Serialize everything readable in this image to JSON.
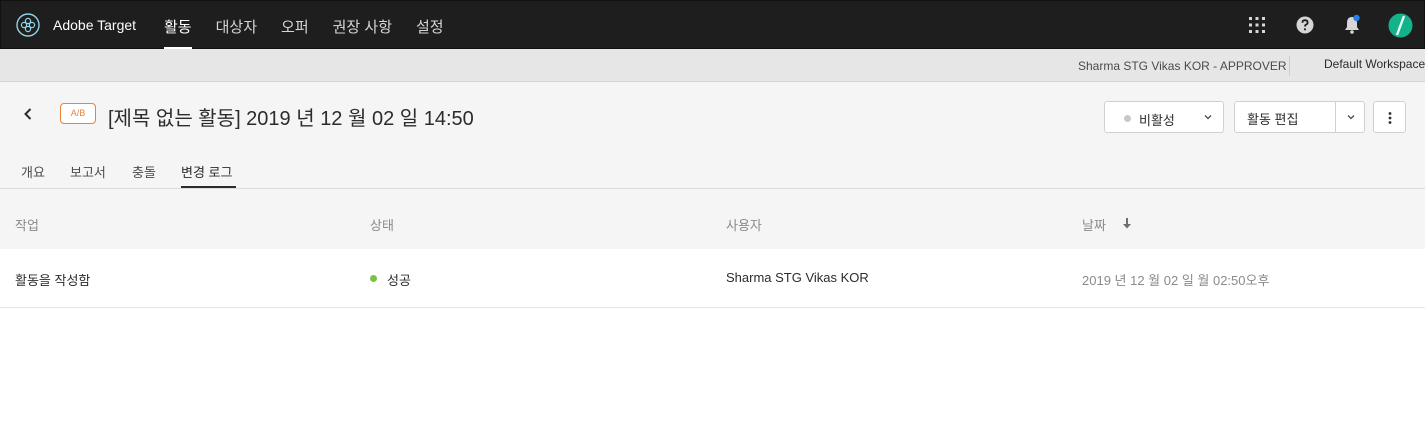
{
  "app": {
    "name": "Adobe Target",
    "nav": [
      "활동",
      "대상자",
      "오퍼",
      "권장 사항",
      "설정"
    ],
    "active_nav_index": 0
  },
  "workspace": {
    "user": "Sharma STG Vikas KOR - APPROVER",
    "name": "Default Workspace"
  },
  "activity": {
    "type_badge": "A/B",
    "title": "[제목 없는 활동] 2019 년 12 월 02 일 14:50",
    "status": "비활성",
    "edit_label": "활동 편집"
  },
  "tabs": [
    "개요",
    "보고서",
    "충돌",
    "변경 로그"
  ],
  "active_tab_index": 3,
  "table": {
    "headers": [
      "작업",
      "상태",
      "사용자",
      "날짜"
    ],
    "sort_column": "날짜",
    "rows": [
      {
        "action": "활동을 작성함",
        "status": "성공",
        "user": "Sharma STG Vikas KOR",
        "date": "2019 년 12 월 02 일 월 02:50오후"
      }
    ]
  },
  "colors": {
    "topbar": "#1e1e1e",
    "badge": "#e8833a",
    "success": "#7bc142",
    "notification": "#2680eb",
    "avatar": "#12b38a"
  },
  "icons": [
    "target-logo-icon",
    "apps-grid-icon",
    "help-icon",
    "bell-icon",
    "avatar",
    "back-chevron-icon",
    "chevron-down-icon",
    "more-vertical-icon",
    "sort-down-icon"
  ]
}
